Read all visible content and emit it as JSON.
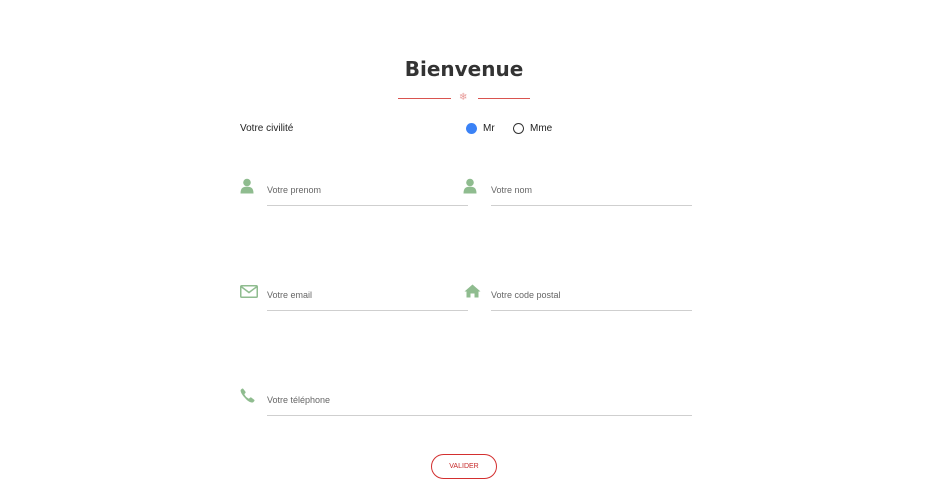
{
  "title": "Bienvenue",
  "divider_ornament": "❄",
  "civility": {
    "label": "Votre civilité",
    "options": [
      {
        "label": "Mr",
        "selected": true
      },
      {
        "label": "Mme",
        "selected": false
      }
    ]
  },
  "fields": {
    "prenom": {
      "placeholder": "Votre prenom",
      "icon": "user-icon"
    },
    "nom": {
      "placeholder": "Votre nom",
      "icon": "user-icon"
    },
    "email": {
      "placeholder": "Votre email",
      "icon": "envelope-icon"
    },
    "code_postal": {
      "placeholder": "Votre code postal",
      "icon": "home-icon"
    },
    "telephone": {
      "placeholder": "Votre téléphone",
      "icon": "phone-icon"
    }
  },
  "submit_label": "VALIDER",
  "colors": {
    "icon": "#8fbc8f",
    "accent": "#d32f2f",
    "radio_checked": "#3b82f6",
    "underline": "#cfcfcf"
  }
}
